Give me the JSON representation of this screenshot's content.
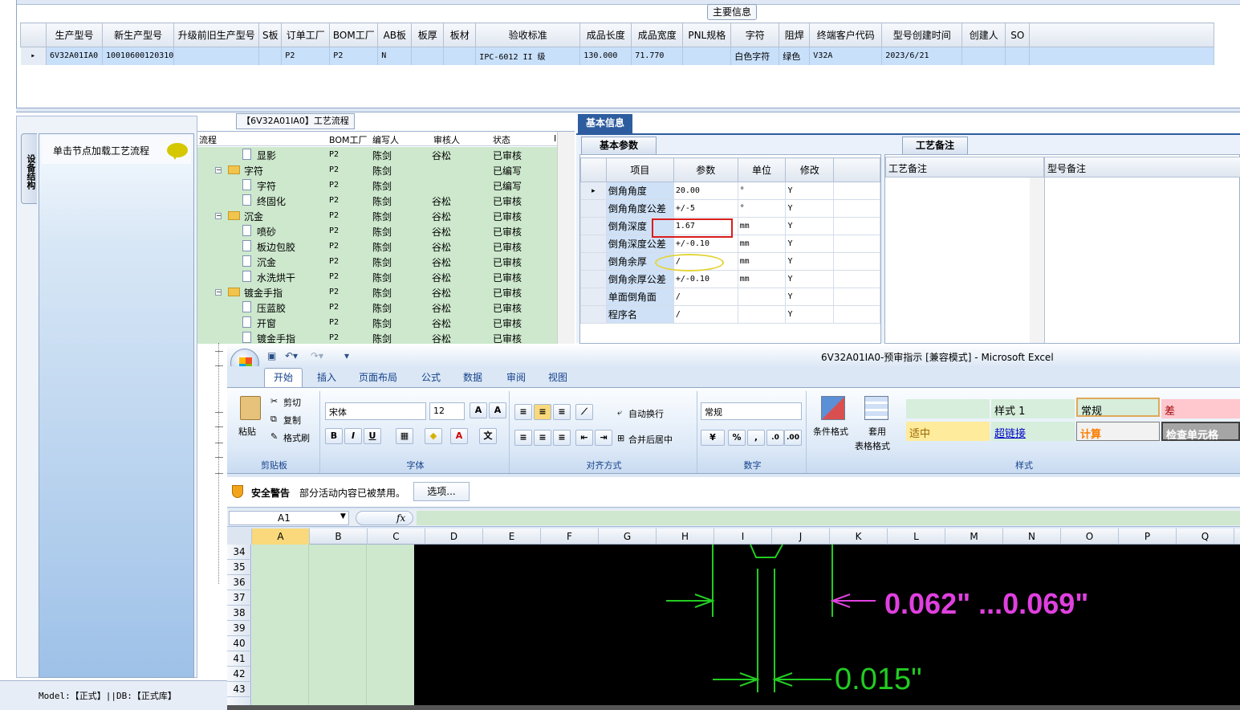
{
  "main_info": {
    "title": "主要信息",
    "columns": [
      "生产型号",
      "新生产型号",
      "升级前旧生产型号",
      "S板",
      "订单工厂",
      "BOM工厂",
      "AB板",
      "板厚",
      "板材",
      "验收标准",
      "成品长度",
      "成品宽度",
      "PNL规格",
      "字符",
      "阻焊",
      "终端客户代码",
      "型号创建时间",
      "创建人",
      "SO"
    ],
    "row": [
      "6V32A01IA0",
      "10010600120310",
      "",
      "",
      "P2",
      "P2",
      "N",
      "",
      "",
      "IPC-6012 II 级",
      "130.000",
      "71.770",
      "",
      "白色字符",
      "绿色",
      "V32A",
      "2023/6/21",
      "",
      ""
    ]
  },
  "left_dock": {
    "tab_label": "设备结构",
    "hint": "单击节点加载工艺流程"
  },
  "process": {
    "title": "【6V32A01IA0】工艺流程",
    "columns": [
      "流程",
      "BOM工厂",
      "编写人",
      "审核人",
      "状态",
      "I"
    ],
    "rows": [
      {
        "name": "显影",
        "level": 2,
        "factory": "P2",
        "writer": "陈剑",
        "reviewer": "谷松",
        "status": "已审核"
      },
      {
        "name": "字符",
        "level": 1,
        "factory": "P2",
        "writer": "陈剑",
        "reviewer": "",
        "status": "已编写"
      },
      {
        "name": "字符",
        "level": 2,
        "factory": "P2",
        "writer": "陈剑",
        "reviewer": "",
        "status": "已编写"
      },
      {
        "name": "终固化",
        "level": 2,
        "factory": "P2",
        "writer": "陈剑",
        "reviewer": "谷松",
        "status": "已审核"
      },
      {
        "name": "沉金",
        "level": 1,
        "factory": "P2",
        "writer": "陈剑",
        "reviewer": "谷松",
        "status": "已审核"
      },
      {
        "name": "喷砂",
        "level": 2,
        "factory": "P2",
        "writer": "陈剑",
        "reviewer": "谷松",
        "status": "已审核"
      },
      {
        "name": "板边包胶",
        "level": 2,
        "factory": "P2",
        "writer": "陈剑",
        "reviewer": "谷松",
        "status": "已审核"
      },
      {
        "name": "沉金",
        "level": 2,
        "factory": "P2",
        "writer": "陈剑",
        "reviewer": "谷松",
        "status": "已审核"
      },
      {
        "name": "水洗烘干",
        "level": 2,
        "factory": "P2",
        "writer": "陈剑",
        "reviewer": "谷松",
        "status": "已审核"
      },
      {
        "name": "镀金手指",
        "level": 1,
        "factory": "P2",
        "writer": "陈剑",
        "reviewer": "谷松",
        "status": "已审核"
      },
      {
        "name": "压蓝胶",
        "level": 2,
        "factory": "P2",
        "writer": "陈剑",
        "reviewer": "谷松",
        "status": "已审核"
      },
      {
        "name": "开窗",
        "level": 2,
        "factory": "P2",
        "writer": "陈剑",
        "reviewer": "谷松",
        "status": "已审核"
      },
      {
        "name": "镀金手指",
        "level": 2,
        "factory": "P2",
        "writer": "陈剑",
        "reviewer": "谷松",
        "status": "已审核"
      }
    ]
  },
  "basic_info": {
    "tab": "基本信息",
    "param_tab": "基本参数",
    "remark_tab": "工艺备注",
    "columns": [
      "项目",
      "参数",
      "单位",
      "修改"
    ],
    "rows": [
      {
        "item": "倒角角度",
        "param": "20.00",
        "unit": "°",
        "edit": "Y"
      },
      {
        "item": "倒角角度公差",
        "param": "+/-5",
        "unit": "°",
        "edit": "Y"
      },
      {
        "item": "倒角深度",
        "param": "1.67",
        "unit": "mm",
        "edit": "Y"
      },
      {
        "item": "倒角深度公差",
        "param": "+/-0.10",
        "unit": "mm",
        "edit": "Y"
      },
      {
        "item": "倒角余厚",
        "param": "/",
        "unit": "mm",
        "edit": "Y"
      },
      {
        "item": "倒角余厚公差",
        "param": "+/-0.10",
        "unit": "mm",
        "edit": "Y"
      },
      {
        "item": "单面倒角面",
        "param": "/",
        "unit": "",
        "edit": "Y"
      },
      {
        "item": "程序名",
        "param": "/",
        "unit": "",
        "edit": "Y"
      }
    ],
    "remark_columns": [
      "工艺备注",
      "型号备注"
    ]
  },
  "status_bar": "Model:【正式】||DB:【正式库】",
  "excel": {
    "title": "6V32A01IA0-预审指示 [兼容模式] - Microsoft Excel",
    "tabs": [
      "开始",
      "插入",
      "页面布局",
      "公式",
      "数据",
      "审阅",
      "视图"
    ],
    "clipboard": {
      "paste": "粘贴",
      "cut": "剪切",
      "copy": "复制",
      "format_painter": "格式刷",
      "label": "剪贴板"
    },
    "font": {
      "name": "宋体",
      "size": "12",
      "label": "字体"
    },
    "alignment": {
      "wrap": "自动换行",
      "merge": "合并后居中",
      "label": "对齐方式"
    },
    "number": {
      "format": "常规",
      "label": "数字"
    },
    "styles": {
      "conditional": "条件格式",
      "table_format_1": "套用",
      "table_format_2": "表格格式",
      "cells": [
        "样式 1",
        "常规",
        "差",
        "适中",
        "超链接",
        "计算",
        "检查单元格"
      ],
      "label": "样式"
    },
    "security": {
      "title": "安全警告",
      "message": "部分活动内容已被禁用。",
      "options": "选项..."
    },
    "name_box": "A1",
    "fx": "fx",
    "columns": [
      "A",
      "B",
      "C",
      "D",
      "E",
      "F",
      "G",
      "H",
      "I",
      "J",
      "K",
      "L",
      "M",
      "N",
      "O",
      "P",
      "Q"
    ],
    "rows": [
      "34",
      "35",
      "36",
      "37",
      "38",
      "39",
      "40",
      "41",
      "42",
      "43"
    ],
    "drawing": {
      "label_top": "0.062\" ...0.069\"",
      "label_bottom": "0.015\""
    },
    "colors": {
      "drawing_green": "#22cc22",
      "drawing_magenta": "#e040e0"
    }
  }
}
